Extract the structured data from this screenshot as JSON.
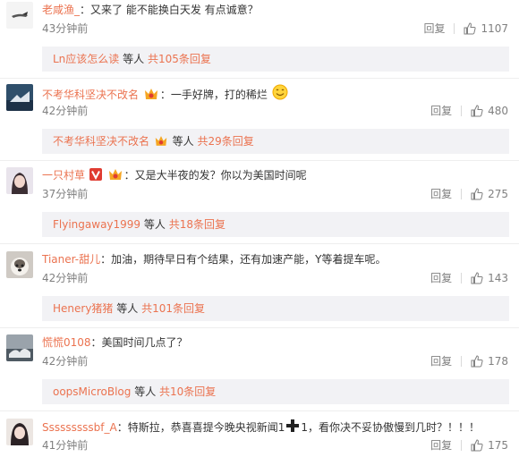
{
  "comments": [
    {
      "username": "老咸渔_",
      "text": "：又来了 能不能换白天发 有点诚意？",
      "time": "43分钟前",
      "reply_label": "回复",
      "likes": "1107",
      "subreply": {
        "name": "Ln应该怎么读",
        "middle": " 等人 ",
        "link": "共105条回复"
      }
    },
    {
      "username": "不考华科坚决不改名",
      "text": "：一手好牌，打的稀烂",
      "time": "42分钟前",
      "reply_label": "回复",
      "likes": "480",
      "subreply": {
        "name": "不考华科坚决不改名",
        "middle": " 等人 ",
        "link": "共29条回复"
      }
    },
    {
      "username": "一只村草",
      "text": "：又是大半夜的发？你以为美国时间呢",
      "time": "37分钟前",
      "reply_label": "回复",
      "likes": "275",
      "subreply": {
        "name": "Flyingaway1999",
        "middle": " 等人 ",
        "link": "共18条回复"
      }
    },
    {
      "username": "Tianer-甜儿",
      "text": "：加油，期待早日有个结果，还有加速产能，Y等着提车呢。",
      "time": "42分钟前",
      "reply_label": "回复",
      "likes": "143",
      "subreply": {
        "name": "Henery猪猪",
        "middle": " 等人 ",
        "link": "共101条回复"
      }
    },
    {
      "username": "慌慌0108",
      "text": "：美国时间几点了？",
      "time": "42分钟前",
      "reply_label": "回复",
      "likes": "178",
      "subreply": {
        "name": "oopsMicroBlog",
        "middle": " 等人 ",
        "link": "共10条回复"
      }
    },
    {
      "username": "Sssssssssbf_A",
      "text": "：特斯拉，恭喜喜提今晚央视新闻1",
      "text_after": "1，看你决不妥协傲慢到几时？！！！",
      "time": "41分钟前",
      "reply_label": "回复",
      "likes": "175"
    }
  ],
  "colors": {
    "username": "#eb7350",
    "text": "#333333",
    "meta": "#808080",
    "subreply_bg": "#f2f2f5"
  },
  "icons": {
    "like": "thumbs-up-icon",
    "vip": "vip-badge-icon",
    "verified": "verified-v-icon",
    "smile": "smile-emoji-icon",
    "cross": "black-cross-emoji-icon"
  }
}
